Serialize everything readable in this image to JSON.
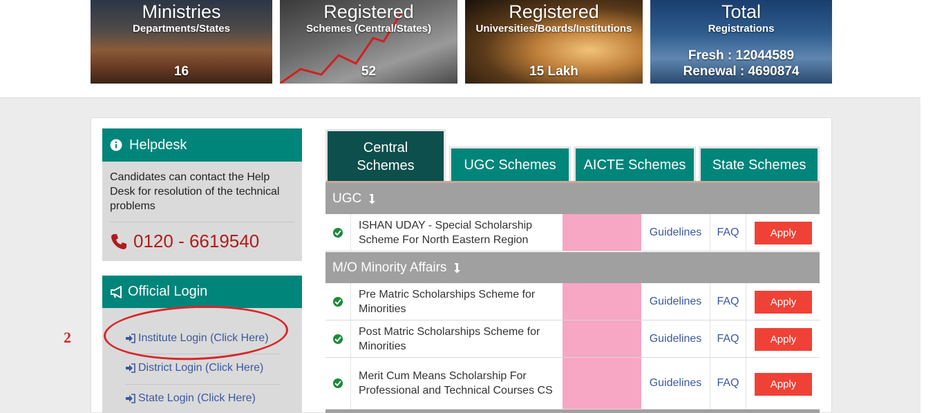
{
  "stats": {
    "ministries": {
      "title": "Ministries",
      "subtitle": "Departments/States",
      "value": "16"
    },
    "schemes": {
      "title": "Registered",
      "subtitle": "Schemes (Central/States)",
      "value": "52"
    },
    "universities": {
      "title": "Registered",
      "subtitle": "Universities/Boards/Institutions",
      "value": "15 Lakh"
    },
    "total": {
      "title": "Total",
      "subtitle": "Registrations",
      "fresh": "Fresh : 12044589",
      "renewal": "Renewal : 4690874"
    }
  },
  "helpdesk": {
    "title": "Helpdesk",
    "text": "Candidates can contact the Help Desk for resolution of the technical problems",
    "phone": "0120 - 6619540"
  },
  "official_login": {
    "title": "Official Login",
    "links": [
      "Institute Login (Click Here)",
      "District Login (Click Here)",
      "State Login (Click Here)"
    ]
  },
  "annotation": {
    "label": "2"
  },
  "tabs": [
    "Central Schemes",
    "UGC Schemes",
    "AICTE Schemes",
    "State Schemes"
  ],
  "groups": [
    {
      "name": "UGC",
      "schemes": [
        {
          "name": "ISHAN UDAY - Special Scholarship Scheme For North Eastern Region",
          "guidelines": "Guidelines",
          "faq": "FAQ",
          "apply": "Apply"
        }
      ]
    },
    {
      "name": "M/O Minority Affairs",
      "schemes": [
        {
          "name": "Pre Matric Scholarships Scheme for Minorities",
          "guidelines": "Guidelines",
          "faq": "FAQ",
          "apply": "Apply"
        },
        {
          "name": "Post Matric Scholarships Scheme for Minorities",
          "guidelines": "Guidelines",
          "faq": "FAQ",
          "apply": "Apply"
        },
        {
          "name": "Merit Cum Means Scholarship For Professional and Technical Courses CS",
          "guidelines": "Guidelines",
          "faq": "FAQ",
          "apply": "Apply"
        }
      ]
    }
  ],
  "colors": {
    "teal": "#00857a",
    "dark_teal": "#0c4f4c",
    "apply_red": "#f04136",
    "phone_red": "#b11b1b",
    "link_blue": "#3a58a0",
    "annotation_red": "#d8262a",
    "highlight_pink": "#f7a6c4"
  },
  "icons": {
    "helpdesk": "info-circle-icon",
    "login": "megaphone-icon",
    "phone": "phone-icon",
    "link": "sign-in-icon",
    "group_sort": "arrow-down-icon",
    "status": "check-circle-icon"
  }
}
